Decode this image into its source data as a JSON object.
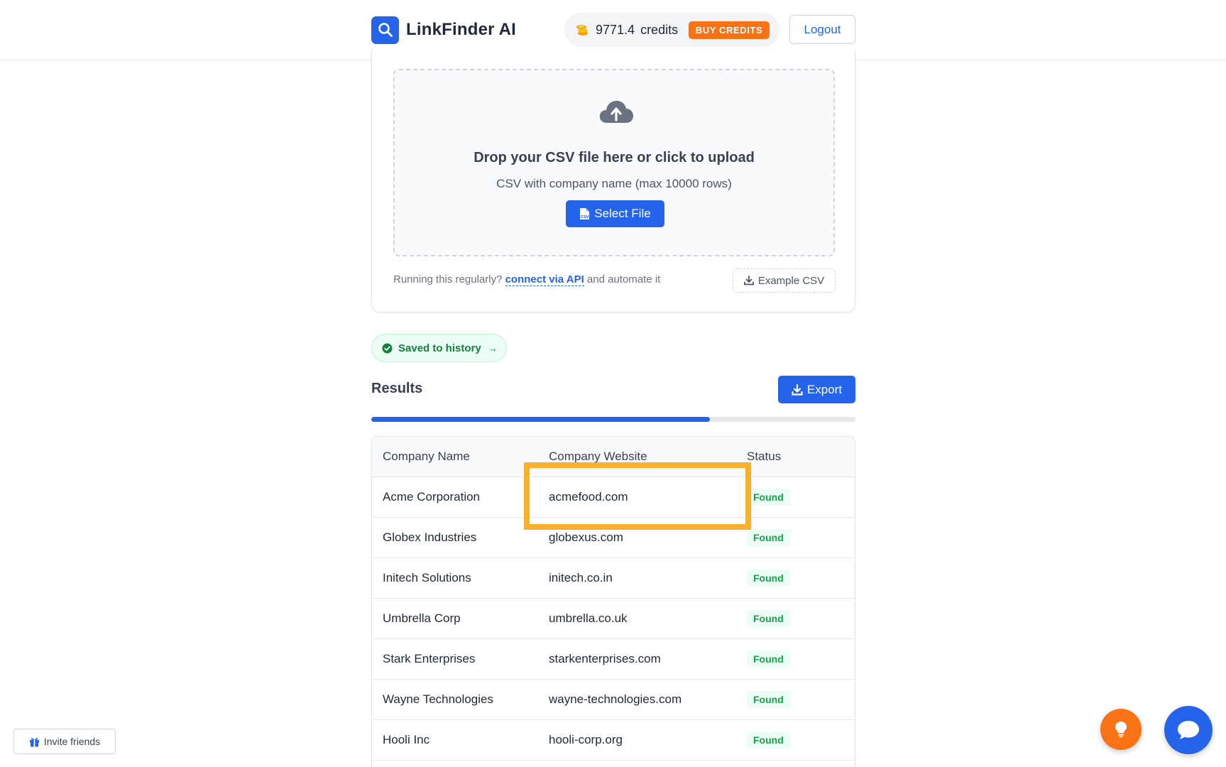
{
  "header": {
    "app_name": "LinkFinder AI",
    "credits_value": "9771.4",
    "credits_label": "credits",
    "buy_label": "BUY CREDITS",
    "logout_label": "Logout"
  },
  "upload": {
    "title": "Drop your CSV file here or click to upload",
    "subtitle": "CSV with company name (max 10000 rows)",
    "select_label": "Select File",
    "api_prefix": "Running this regularly?",
    "api_link": "connect via API",
    "api_suffix": "and automate it",
    "example_label": "Example CSV"
  },
  "saved_label": "Saved to history",
  "results": {
    "title": "Results",
    "export_label": "Export",
    "progress": 0.7,
    "columns": [
      "Company Name",
      "Company Website",
      "Status"
    ],
    "rows": [
      {
        "name": "Acme Corporation",
        "website": "acmefood.com",
        "status": "Found"
      },
      {
        "name": "Globex Industries",
        "website": "globexus.com",
        "status": "Found"
      },
      {
        "name": "Initech Solutions",
        "website": "initech.co.in",
        "status": "Found"
      },
      {
        "name": "Umbrella Corp",
        "website": "umbrella.co.uk",
        "status": "Found"
      },
      {
        "name": "Stark Enterprises",
        "website": "starkenterprises.com",
        "status": "Found"
      },
      {
        "name": "Wayne Technologies",
        "website": "wayne-technologies.com",
        "status": "Found"
      },
      {
        "name": "Hooli Inc",
        "website": "hooli-corp.org",
        "status": "Found"
      }
    ]
  },
  "invite_label": "Invite friends",
  "icons": {
    "logo": "search-icon",
    "credits": "coins-icon",
    "upload": "cloud-upload-icon",
    "select": "csv-file-icon",
    "example": "download-icon",
    "saved": "check-circle-icon",
    "export": "download-icon",
    "invite": "gift-icon",
    "tip": "lightbulb-icon",
    "chat": "chat-bubble-icon"
  },
  "colors": {
    "primary": "#2563eb",
    "accent": "#f97316",
    "success": "#16a34a",
    "highlight": "#fbb02d"
  }
}
